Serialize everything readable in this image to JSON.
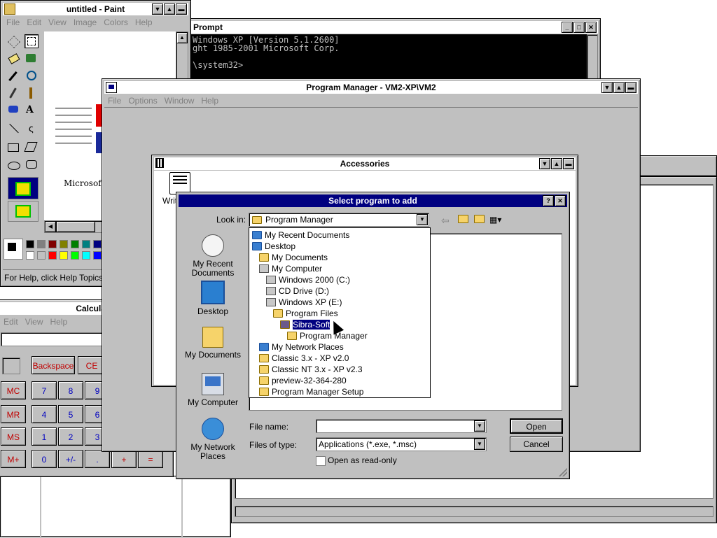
{
  "paint": {
    "title": "untitled - Paint",
    "menu": [
      "File",
      "Edit",
      "View",
      "Image",
      "Colors",
      "Help"
    ],
    "canvas_text": "Microsoft Wo",
    "status": "For Help, click Help Topics"
  },
  "prompt": {
    "title": "Prompt",
    "lines": [
      "Windows XP [Version 5.1.2600]",
      "ght 1985-2001 Microsoft Corp.",
      "",
      "\\system32>"
    ]
  },
  "progman": {
    "title": "Program Manager - VM2-XP\\VM2",
    "menu": [
      "File",
      "Options",
      "Window",
      "Help"
    ]
  },
  "accessories": {
    "title": "Accessories",
    "icon_label": "Writ"
  },
  "calculator": {
    "title": "Calculator Plus",
    "menu": [
      "Edit",
      "View",
      "Help"
    ],
    "row1": [
      "Backspace",
      "CE"
    ],
    "mem": [
      "MC",
      "MR",
      "MS",
      "M+"
    ],
    "digits": [
      [
        "7",
        "8",
        "9"
      ],
      [
        "4",
        "5",
        "6"
      ],
      [
        "1",
        "2",
        "3"
      ],
      [
        "0",
        "+/-",
        ".",
        "+",
        "="
      ]
    ]
  },
  "dialog": {
    "title": "Select program to add",
    "help_btn": "?",
    "close_btn": "✕",
    "look_in_label": "Look in:",
    "look_in_value": "Program Manager",
    "places": [
      {
        "icon": "recent-documents-icon",
        "label": "My Recent Documents"
      },
      {
        "icon": "desktop-icon",
        "label": "Desktop"
      },
      {
        "icon": "my-documents-icon",
        "label": "My Documents"
      },
      {
        "icon": "my-computer-icon",
        "label": "My Computer"
      },
      {
        "icon": "network-places-icon",
        "label": "My Network Places"
      }
    ],
    "tree": [
      {
        "label": "My Recent Documents",
        "level": 0,
        "icon": "recent"
      },
      {
        "label": "Desktop",
        "level": 0,
        "icon": "desktop"
      },
      {
        "label": "My Documents",
        "level": 1,
        "icon": "folder"
      },
      {
        "label": "My Computer",
        "level": 1,
        "icon": "computer"
      },
      {
        "label": "Windows 2000 (C:)",
        "level": 2,
        "icon": "drive"
      },
      {
        "label": "CD Drive (D:)",
        "level": 2,
        "icon": "cd"
      },
      {
        "label": "Windows XP (E:)",
        "level": 2,
        "icon": "drive"
      },
      {
        "label": "Program Files",
        "level": 3,
        "icon": "folder"
      },
      {
        "label": "Sibra-Soft",
        "level": 4,
        "icon": "folder-open",
        "selected": true
      },
      {
        "label": "Program Manager",
        "level": 5,
        "icon": "folder"
      },
      {
        "label": "My Network Places",
        "level": 1,
        "icon": "network"
      },
      {
        "label": "Classic 3.x - XP v2.0",
        "level": 1,
        "icon": "folder"
      },
      {
        "label": "Classic NT 3.x - XP v2.3",
        "level": 1,
        "icon": "folder"
      },
      {
        "label": "preview-32-364-280",
        "level": 1,
        "icon": "folder"
      },
      {
        "label": "Program Manager Setup",
        "level": 1,
        "icon": "folder"
      }
    ],
    "file_name_label": "File name:",
    "file_name_value": "",
    "files_of_type_label": "Files of type:",
    "files_of_type_value": "Applications (*.exe, *.msc)",
    "readonly_label": "Open as read-only",
    "open_btn": "Open",
    "cancel_btn": "Cancel"
  }
}
